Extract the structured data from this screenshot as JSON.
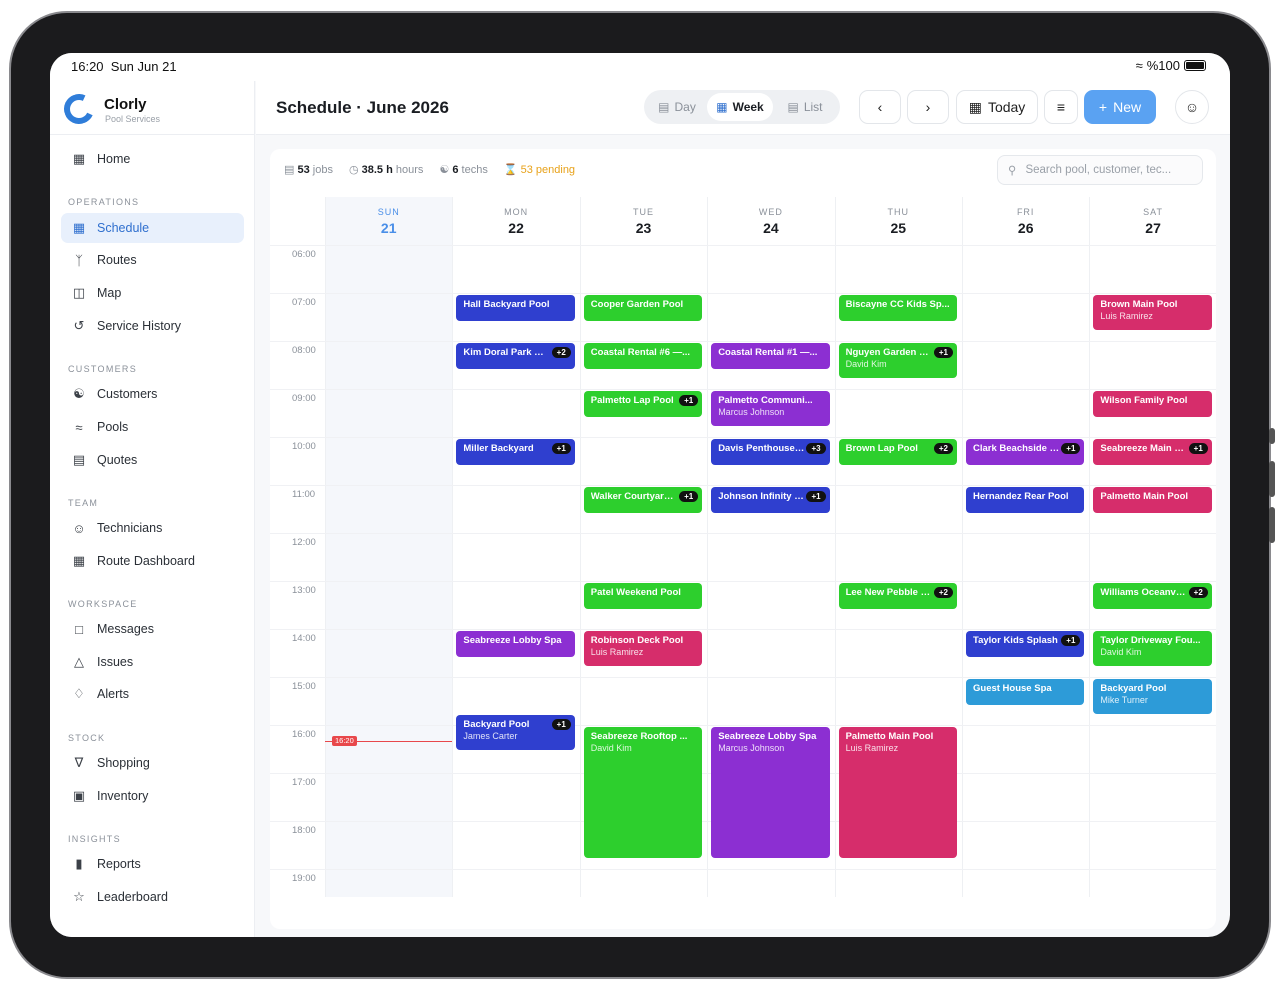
{
  "status": {
    "time": "16:20",
    "date": "Sun Jun 21",
    "battery": "%100"
  },
  "brand": {
    "name": "Clorly",
    "subtitle": "Pool Services"
  },
  "nav": {
    "home": "Home",
    "sections": {
      "operations": "OPERATIONS",
      "customers": "CUSTOMERS",
      "team": "TEAM",
      "workspace": "WORKSPACE",
      "stock": "STOCK",
      "insights": "INSIGHTS"
    },
    "items": {
      "schedule": "Schedule",
      "routes": "Routes",
      "map": "Map",
      "history": "Service History",
      "customers": "Customers",
      "pools": "Pools",
      "quotes": "Quotes",
      "technicians": "Technicians",
      "route_dashboard": "Route Dashboard",
      "messages": "Messages",
      "issues": "Issues",
      "alerts": "Alerts",
      "shopping": "Shopping",
      "inventory": "Inventory",
      "reports": "Reports",
      "leaderboard": "Leaderboard"
    }
  },
  "header": {
    "title": "Schedule · June 2026",
    "views": {
      "day": "Day",
      "week": "Week",
      "list": "List"
    },
    "today": "Today",
    "new": "New"
  },
  "stats": {
    "jobs_n": "53",
    "jobs": "jobs",
    "hours_n": "38.5 h",
    "hours": "hours",
    "techs_n": "6",
    "techs": "techs",
    "pending": "53 pending"
  },
  "search": {
    "placeholder": "Search pool, customer, tec..."
  },
  "days": [
    {
      "name": "SUN",
      "date": "21"
    },
    {
      "name": "MON",
      "date": "22"
    },
    {
      "name": "TUE",
      "date": "23"
    },
    {
      "name": "WED",
      "date": "24"
    },
    {
      "name": "THU",
      "date": "25"
    },
    {
      "name": "FRI",
      "date": "26"
    },
    {
      "name": "SAT",
      "date": "27"
    }
  ],
  "hours": [
    "06:00",
    "07:00",
    "08:00",
    "09:00",
    "10:00",
    "11:00",
    "12:00",
    "13:00",
    "14:00",
    "15:00",
    "16:00",
    "17:00",
    "18:00",
    "19:00"
  ],
  "now": "16:20",
  "events": [
    {
      "day": 1,
      "start": 7,
      "dur": 0.6,
      "color": "blue",
      "title": "Hall Backyard Pool"
    },
    {
      "day": 1,
      "start": 8,
      "dur": 0.6,
      "color": "blue",
      "title": "Kim Doral Park Pool",
      "badge": "+2"
    },
    {
      "day": 1,
      "start": 10,
      "dur": 0.6,
      "color": "blue",
      "title": "Miller Backyard",
      "badge": "+1"
    },
    {
      "day": 1,
      "start": 14,
      "dur": 0.6,
      "color": "purple",
      "title": "Seabreeze Lobby Spa"
    },
    {
      "day": 1,
      "start": 15.75,
      "dur": 0.8,
      "color": "blue",
      "title": "Backyard Pool",
      "sub": "James Carter",
      "badge": "+1"
    },
    {
      "day": 2,
      "start": 7,
      "dur": 0.6,
      "color": "green",
      "title": "Cooper Garden Pool"
    },
    {
      "day": 2,
      "start": 8,
      "dur": 0.6,
      "color": "green",
      "title": "Coastal Rental #6 —..."
    },
    {
      "day": 2,
      "start": 9,
      "dur": 0.6,
      "color": "green",
      "title": "Palmetto Lap Pool",
      "badge": "+1"
    },
    {
      "day": 2,
      "start": 11,
      "dur": 0.6,
      "color": "green",
      "title": "Walker Courtyard Pool",
      "badge": "+1"
    },
    {
      "day": 2,
      "start": 13,
      "dur": 0.6,
      "color": "green",
      "title": "Patel Weekend Pool"
    },
    {
      "day": 2,
      "start": 14,
      "dur": 0.8,
      "color": "pink",
      "title": "Robinson Deck Pool",
      "sub": "Luis Ramirez"
    },
    {
      "day": 2,
      "start": 16,
      "dur": 2.8,
      "color": "green",
      "title": "Seabreeze Rooftop ...",
      "sub": "David Kim"
    },
    {
      "day": 3,
      "start": 8,
      "dur": 0.6,
      "color": "purple",
      "title": "Coastal Rental #1 —..."
    },
    {
      "day": 3,
      "start": 9,
      "dur": 0.8,
      "color": "purple",
      "title": "Palmetto Communi...",
      "sub": "Marcus Johnson"
    },
    {
      "day": 3,
      "start": 10,
      "dur": 0.6,
      "color": "blue",
      "title": "Davis Penthouse Pool",
      "badge": "+3"
    },
    {
      "day": 3,
      "start": 11,
      "dur": 0.6,
      "color": "blue",
      "title": "Johnson Infinity Pool",
      "badge": "+1"
    },
    {
      "day": 3,
      "start": 16,
      "dur": 2.8,
      "color": "purple",
      "title": "Seabreeze Lobby Spa",
      "sub": "Marcus Johnson"
    },
    {
      "day": 4,
      "start": 7,
      "dur": 0.6,
      "color": "green",
      "title": "Biscayne CC Kids Sp..."
    },
    {
      "day": 4,
      "start": 8,
      "dur": 0.8,
      "color": "green",
      "title": "Nguyen Garden Pool",
      "sub": "David Kim",
      "badge": "+1"
    },
    {
      "day": 4,
      "start": 10,
      "dur": 0.6,
      "color": "green",
      "title": "Brown Lap Pool",
      "badge": "+2"
    },
    {
      "day": 4,
      "start": 13,
      "dur": 0.6,
      "color": "green",
      "title": "Lee New Pebble Pool",
      "badge": "+2"
    },
    {
      "day": 4,
      "start": 16,
      "dur": 2.8,
      "color": "pink",
      "title": "Palmetto Main Pool",
      "sub": "Luis Ramirez"
    },
    {
      "day": 5,
      "start": 10,
      "dur": 0.6,
      "color": "purple",
      "title": "Clark Beachside Pool",
      "badge": "+1"
    },
    {
      "day": 5,
      "start": 11,
      "dur": 0.6,
      "color": "blue",
      "title": "Hernandez Rear Pool"
    },
    {
      "day": 5,
      "start": 14,
      "dur": 0.6,
      "color": "blue",
      "title": "Taylor Kids Splash",
      "badge": "+1"
    },
    {
      "day": 5,
      "start": 15,
      "dur": 0.6,
      "color": "cyan",
      "title": "Guest House Spa"
    },
    {
      "day": 6,
      "start": 7,
      "dur": 0.8,
      "color": "pink",
      "title": "Brown Main Pool",
      "sub": "Luis Ramirez"
    },
    {
      "day": 6,
      "start": 9,
      "dur": 0.6,
      "color": "pink",
      "title": "Wilson Family Pool"
    },
    {
      "day": 6,
      "start": 10,
      "dur": 0.6,
      "color": "pink",
      "title": "Seabreeze Main Pool",
      "badge": "+1"
    },
    {
      "day": 6,
      "start": 11,
      "dur": 0.6,
      "color": "pink",
      "title": "Palmetto Main Pool"
    },
    {
      "day": 6,
      "start": 13,
      "dur": 0.6,
      "color": "green",
      "title": "Williams Oceanview",
      "badge": "+2"
    },
    {
      "day": 6,
      "start": 14,
      "dur": 0.8,
      "color": "green",
      "title": "Taylor Driveway Fou...",
      "sub": "David Kim"
    },
    {
      "day": 6,
      "start": 15,
      "dur": 0.8,
      "color": "cyan",
      "title": "Backyard Pool",
      "sub": "Mike Turner"
    }
  ]
}
